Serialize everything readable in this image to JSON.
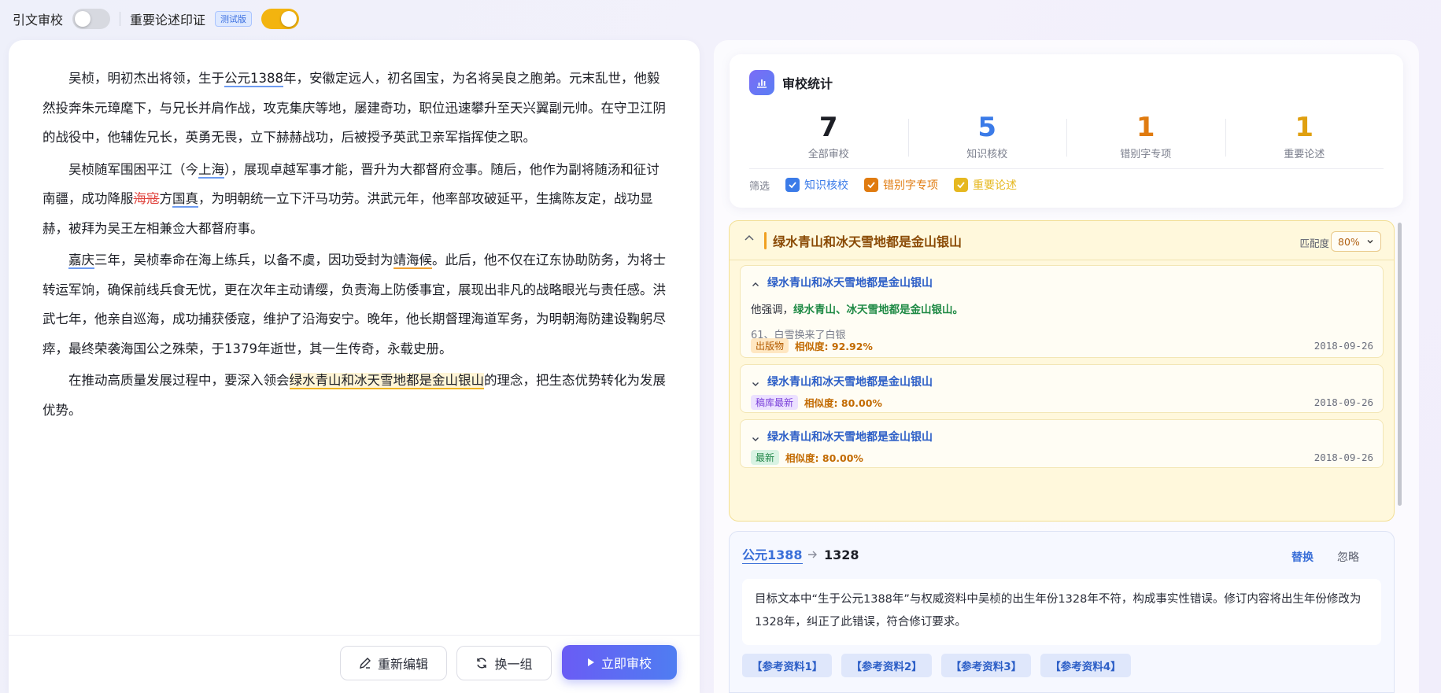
{
  "topbar": {
    "citation_label": "引文审校",
    "citation_toggle_on": false,
    "important_label": "重要论述印证",
    "beta_badge": "测试版",
    "important_toggle_on": true,
    "colors": {
      "toggle_on": "#f3b40f",
      "toggle_off": "#d7d9e0"
    }
  },
  "document": {
    "paragraphs": [
      [
        {
          "t": "吴桢，明初杰出将领，生于"
        },
        {
          "t": "公元1388",
          "mark": "blue"
        },
        {
          "t": "年，安徽定远人，初名国宝，为名将吴良之胞弟。元末乱世，他毅然投奔朱元璋麾下，与兄长并肩作战，攻克集庆等地，屡建奇功，职位迅速攀升至天兴翼副元帅。在守卫江阴的战役中，他辅佐兄长，英勇无畏，立下赫赫战功，后被授予英武卫亲军指挥使之职。"
        }
      ],
      [
        {
          "t": "吴桢随军围困平江（今"
        },
        {
          "t": "上海",
          "mark": "blue"
        },
        {
          "t": "），展现卓越军事才能，晋升为大都督府佥事。随后，他作为副将随汤和征讨南疆，成功降服"
        },
        {
          "t": "海寇",
          "mark": "wrong"
        },
        {
          "t": "方"
        },
        {
          "t": "国真",
          "mark": "blue"
        },
        {
          "t": "，为明朝统一立下汗马功劳。洪武元年，他率部攻破延平，生擒陈友定，战功显赫，被拜为吴王左相兼佥大都督府事。"
        }
      ],
      [
        {
          "t": "嘉庆",
          "mark": "blue"
        },
        {
          "t": "三年，吴桢奉命在海上练兵，以备不虞，因功受封为"
        },
        {
          "t": "靖海候",
          "mark": "orange"
        },
        {
          "t": "。此后，他不仅在辽东协助防务，为将士转运军饷，确保前线兵食无忧，更在次年主动请缨，负责海上防倭事宜，展现出非凡的战略眼光与责任感。洪武七年，他亲自巡海，成功捕获倭寇，维护了沿海安宁。晚年，他长期督理海道军务，为明朝海防建设鞠躬尽瘁，最终荣袭海国公之殊荣，于1379年逝世，其一生传奇，永载史册。"
        }
      ],
      [
        {
          "t": "在推动高质量发展过程中，要深入领会"
        },
        {
          "t": "绿水青山和冰天雪地都是金山银山",
          "mark": "yellow"
        },
        {
          "t": "的理念，把生态优势转化为发展优势。"
        }
      ]
    ]
  },
  "actions": {
    "reedit": "重新编辑",
    "swap": "换一组",
    "review": "立即审校"
  },
  "stats": {
    "title": "审校统计",
    "items": [
      {
        "value": "7",
        "label": "全部审校",
        "color": "#1d1f26"
      },
      {
        "value": "5",
        "label": "知识核校",
        "color": "#3b7be8"
      },
      {
        "value": "1",
        "label": "错别字专项",
        "color": "#e07b10"
      },
      {
        "value": "1",
        "label": "重要论述",
        "color": "#e0a010"
      }
    ],
    "filter_label": "筛选",
    "filters": [
      {
        "label": "知识核校",
        "checked": true,
        "color": "#3b7be8"
      },
      {
        "label": "错别字专项",
        "checked": true,
        "color": "#e07b10"
      },
      {
        "label": "重要论述",
        "checked": true,
        "color": "#e6b820"
      }
    ]
  },
  "match": {
    "title": "绿水青山和冰天雪地都是金山银山",
    "degree_label": "匹配度",
    "degree_value": "80%",
    "items": [
      {
        "title": "绿水青山和冰天雪地都是金山银山",
        "expanded": true,
        "quote_prefix": "他强调，",
        "quote_hl": "绿水青山、冰天雪地都是金山银山。",
        "ref": "61、白雪换来了白银",
        "tag": "出版物",
        "sim": "相似度: 92.92%",
        "date": "2018-09-26"
      },
      {
        "title": "绿水青山和冰天雪地都是金山银山",
        "expanded": false,
        "tag": "稿库最新",
        "sim": "相似度: 80.00%",
        "date": "2018-09-26"
      },
      {
        "title": "绿水青山和冰天雪地都是金山银山",
        "expanded": false,
        "tag": "最新",
        "sim": "相似度: 80.00%",
        "date": "2018-09-26"
      }
    ]
  },
  "correction": {
    "original": "公元1388",
    "replacement": "1328",
    "replace_label": "替换",
    "ignore_label": "忽略",
    "explanation": "目标文本中“生于公元1388年”与权威资料中吴桢的出生年份1328年不符，构成事实性错误。修订内容将出生年份修改为1328年，纠正了此错误，符合修订要求。",
    "refs": [
      "【参考资料1】",
      "【参考资料2】",
      "【参考资料3】",
      "【参考资料4】"
    ]
  }
}
